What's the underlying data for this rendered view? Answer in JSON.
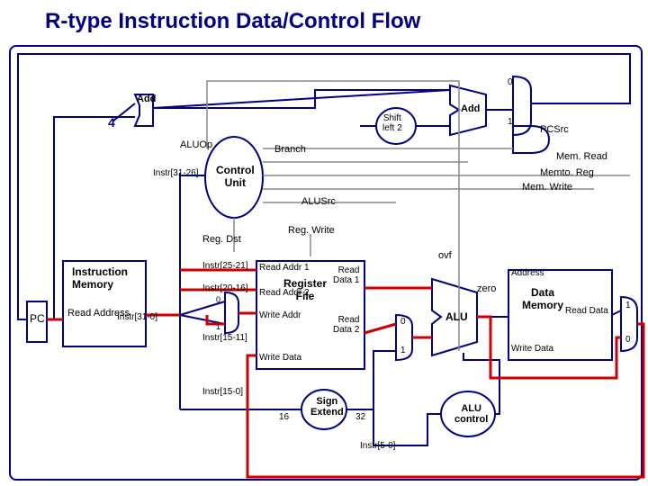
{
  "title": "R-type Instruction Data/Control Flow",
  "blocks": {
    "pc": "PC",
    "instr_mem": "Instruction\nMemory",
    "read_addr": "Read Address",
    "instr_out": "Instr[31-0]",
    "add1": "Add",
    "four": "4",
    "add2": "Add",
    "shift_left": "Shift\nleft 2",
    "control_unit": "Control\nUnit",
    "reg_file": "Register\nFile",
    "read_addr1": "Read Addr 1",
    "read_addr2": "Read Addr 2",
    "write_addr": "Write Addr",
    "write_data_rf": "Write Data",
    "read_data1": "Read\nData 1",
    "read_data2": "Read\nData 2",
    "sign_extend": "Sign\nExtend",
    "sixteen": "16",
    "thirtytwo": "32",
    "alu": "ALU",
    "alu_control": "ALU\ncontrol",
    "ovf": "ovf",
    "zero": "zero",
    "data_mem": "Data\nMemory",
    "address_dm": "Address",
    "read_data_dm": "Read Data",
    "write_data_dm": "Write Data",
    "mux0a": "0",
    "mux1a": "1",
    "mux0b": "0",
    "mux1b": "1",
    "mux0c": "0",
    "mux1c": "1",
    "mux0d": "0",
    "mux1d": "1"
  },
  "signals": {
    "aluop": "ALUOp",
    "branch": "Branch",
    "memread": "Mem. Read",
    "memtoreg": "Memto. Reg",
    "memwrite": "Mem. Write",
    "alusrc": "ALUSrc",
    "regwrite": "Reg. Write",
    "regdst": "Reg. Dst",
    "pcsrc": "PCSrc"
  },
  "fields": {
    "instr31_26": "Instr[31-26]",
    "instr25_21": "Instr[25-21]",
    "instr20_16": "Instr[20-16]",
    "instr15_11": "Instr[15-11]",
    "instr15_0": "Instr[15-0]",
    "instr5_0": "Instr[5-0]"
  }
}
